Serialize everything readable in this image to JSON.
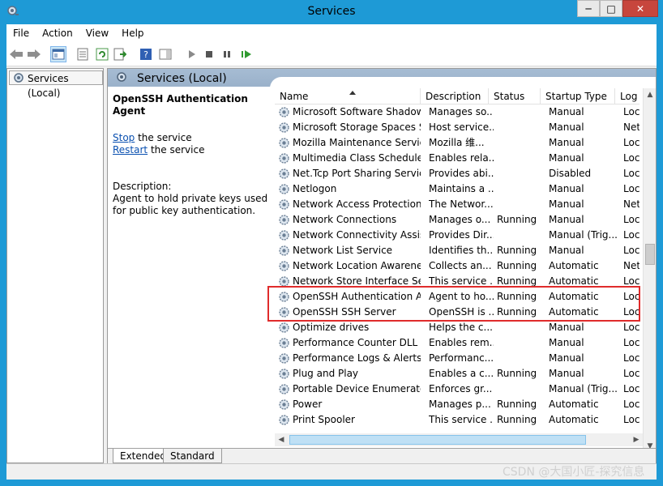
{
  "window": {
    "title": "Services"
  },
  "menubar": {
    "items": [
      "File",
      "Action",
      "View",
      "Help"
    ]
  },
  "tree": {
    "root_label": "Services (Local)"
  },
  "main": {
    "header_title": "Services (Local)",
    "selected_service": "OpenSSH Authentication Agent",
    "stop_link": "Stop",
    "stop_suffix": " the service",
    "restart_link": "Restart",
    "restart_suffix": " the service",
    "description_label": "Description:",
    "description_text": "Agent to hold private keys used for public key authentication."
  },
  "columns": {
    "name": "Name",
    "description": "Description",
    "status": "Status",
    "startup_type": "Startup Type",
    "log_on_as": "Log"
  },
  "services": [
    {
      "name": "Microsoft Software Shadow...",
      "description": "Manages so...",
      "status": "",
      "startup": "Manual",
      "logon": "Loc"
    },
    {
      "name": "Microsoft Storage Spaces S...",
      "description": "Host service...",
      "status": "",
      "startup": "Manual",
      "logon": "Net"
    },
    {
      "name": "Mozilla Maintenance Service",
      "description": "Mozilla 维...",
      "status": "",
      "startup": "Manual",
      "logon": "Loc"
    },
    {
      "name": "Multimedia Class Scheduler",
      "description": "Enables rela...",
      "status": "",
      "startup": "Manual",
      "logon": "Loc"
    },
    {
      "name": "Net.Tcp Port Sharing Service",
      "description": "Provides abi...",
      "status": "",
      "startup": "Disabled",
      "logon": "Loc"
    },
    {
      "name": "Netlogon",
      "description": "Maintains a ...",
      "status": "",
      "startup": "Manual",
      "logon": "Loc"
    },
    {
      "name": "Network Access Protection ...",
      "description": "The Networ...",
      "status": "",
      "startup": "Manual",
      "logon": "Net"
    },
    {
      "name": "Network Connections",
      "description": "Manages o...",
      "status": "Running",
      "startup": "Manual",
      "logon": "Loc"
    },
    {
      "name": "Network Connectivity Assis...",
      "description": "Provides Dir...",
      "status": "",
      "startup": "Manual (Trig...",
      "logon": "Loc"
    },
    {
      "name": "Network List Service",
      "description": "Identifies th...",
      "status": "Running",
      "startup": "Manual",
      "logon": "Loc"
    },
    {
      "name": "Network Location Awareness",
      "description": "Collects an...",
      "status": "Running",
      "startup": "Automatic",
      "logon": "Net"
    },
    {
      "name": "Network Store Interface Ser...",
      "description": "This service ...",
      "status": "Running",
      "startup": "Automatic",
      "logon": "Loc"
    },
    {
      "name": "OpenSSH Authentication A...",
      "description": "Agent to ho...",
      "status": "Running",
      "startup": "Automatic",
      "logon": "Loc"
    },
    {
      "name": "OpenSSH SSH Server",
      "description": "OpenSSH is ...",
      "status": "Running",
      "startup": "Automatic",
      "logon": "Loc"
    },
    {
      "name": "Optimize drives",
      "description": "Helps the c...",
      "status": "",
      "startup": "Manual",
      "logon": "Loc"
    },
    {
      "name": "Performance Counter DLL ...",
      "description": "Enables rem...",
      "status": "",
      "startup": "Manual",
      "logon": "Loc"
    },
    {
      "name": "Performance Logs & Alerts",
      "description": "Performanc...",
      "status": "",
      "startup": "Manual",
      "logon": "Loc"
    },
    {
      "name": "Plug and Play",
      "description": "Enables a c...",
      "status": "Running",
      "startup": "Manual",
      "logon": "Loc"
    },
    {
      "name": "Portable Device Enumerator...",
      "description": "Enforces gr...",
      "status": "",
      "startup": "Manual (Trig...",
      "logon": "Loc"
    },
    {
      "name": "Power",
      "description": "Manages p...",
      "status": "Running",
      "startup": "Automatic",
      "logon": "Loc"
    },
    {
      "name": "Print Spooler",
      "description": "This service ...",
      "status": "Running",
      "startup": "Automatic",
      "logon": "Loc"
    }
  ],
  "tabs": [
    "Extended",
    "Standard"
  ],
  "watermark": "CSDN @大国小匠-探究信息",
  "colors": {
    "title_bar": "#1e9ad6",
    "highlight_border": "#e02b2b",
    "link": "#0a50b0"
  }
}
